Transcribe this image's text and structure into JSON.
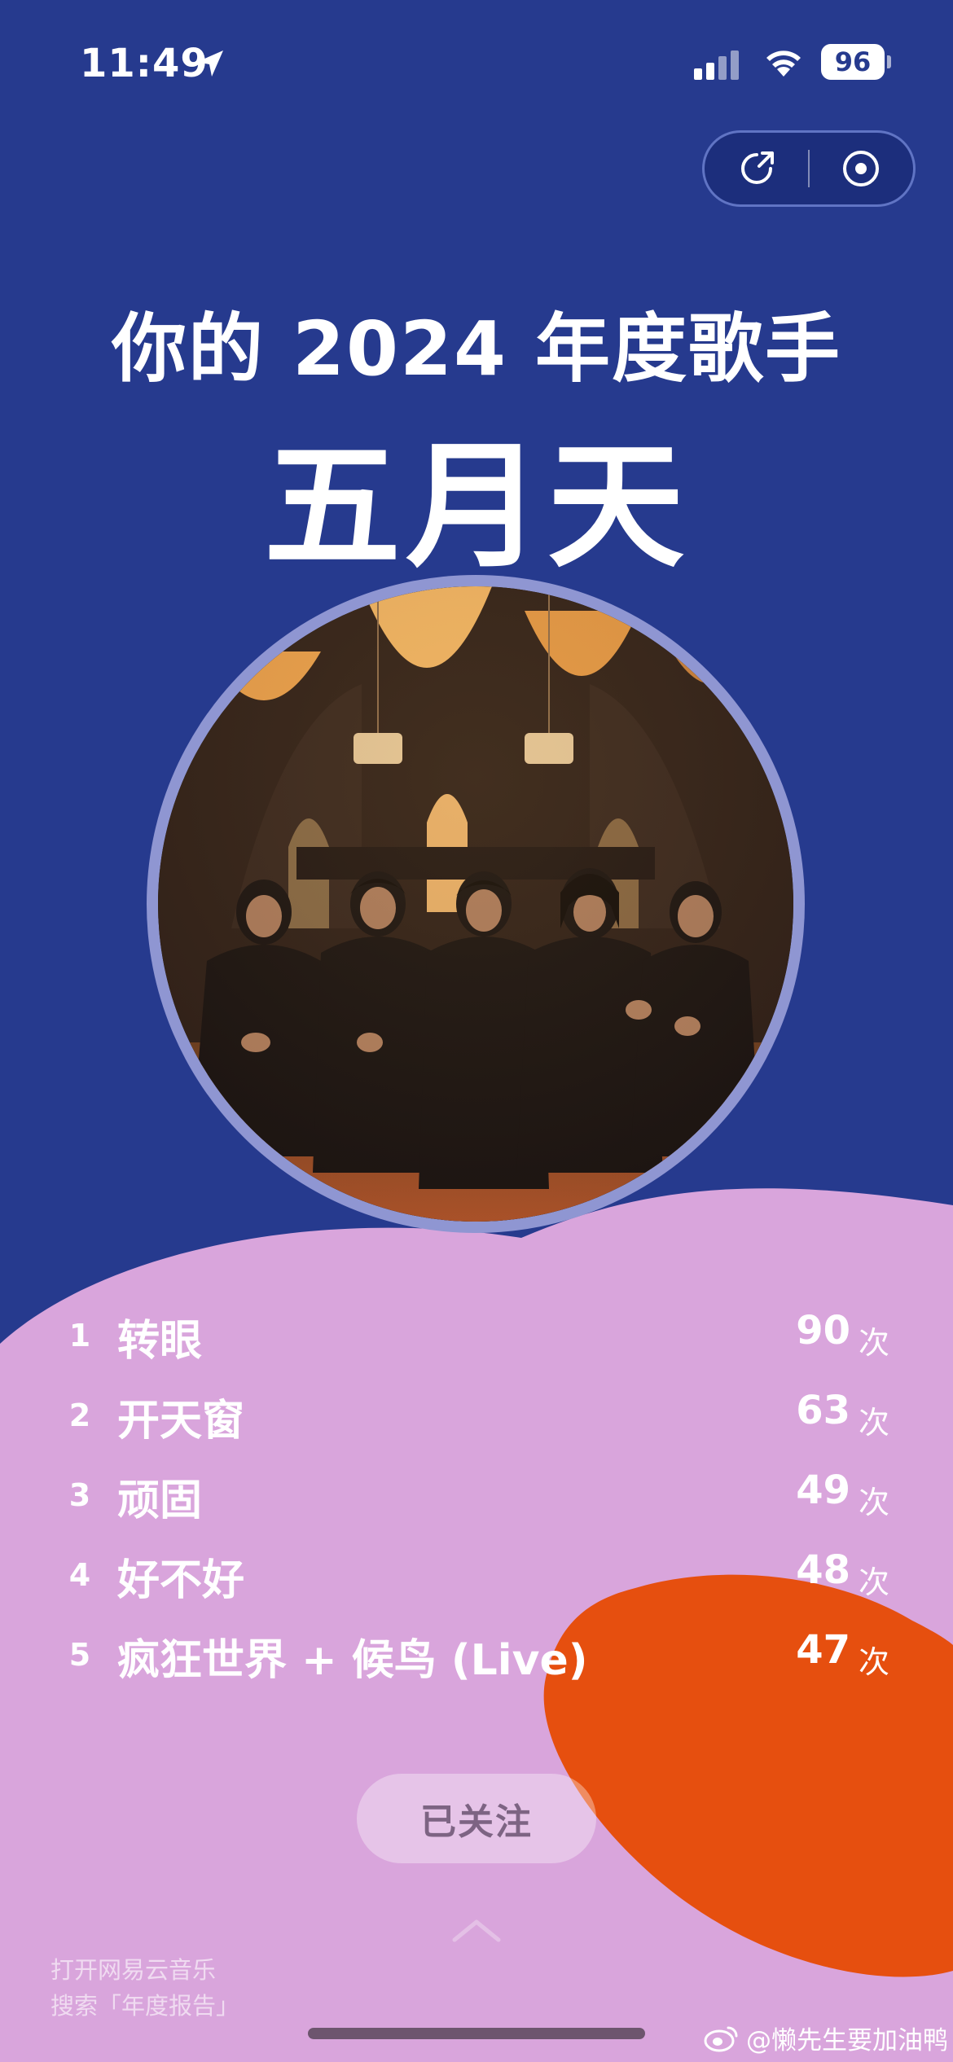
{
  "status_bar": {
    "time": "11:49",
    "battery": "96"
  },
  "capsule": {
    "share_icon": "share-icon",
    "close_icon": "target-icon"
  },
  "header": {
    "title": "你的 2024 年度歌手",
    "artist": "五月天"
  },
  "songs": [
    {
      "rank": "1",
      "title": "转眼",
      "count": "90",
      "unit": "次"
    },
    {
      "rank": "2",
      "title": "开天窗",
      "count": "63",
      "unit": "次"
    },
    {
      "rank": "3",
      "title": "顽固",
      "count": "49",
      "unit": "次"
    },
    {
      "rank": "4",
      "title": "好不好",
      "count": "48",
      "unit": "次"
    },
    {
      "rank": "5",
      "title": "疯狂世界 + 候鸟 (Live)",
      "count": "47",
      "unit": "次"
    }
  ],
  "follow_button": "已关注",
  "hint": {
    "line1": "打开网易云音乐",
    "line2": "搜索「年度报告」"
  },
  "watermark": "@懒先生要加油鸭",
  "colors": {
    "background": "#263a8e",
    "blob_pink": "#d9a5dc",
    "blob_orange": "#e64f0f",
    "ring": "#8f96d2"
  }
}
